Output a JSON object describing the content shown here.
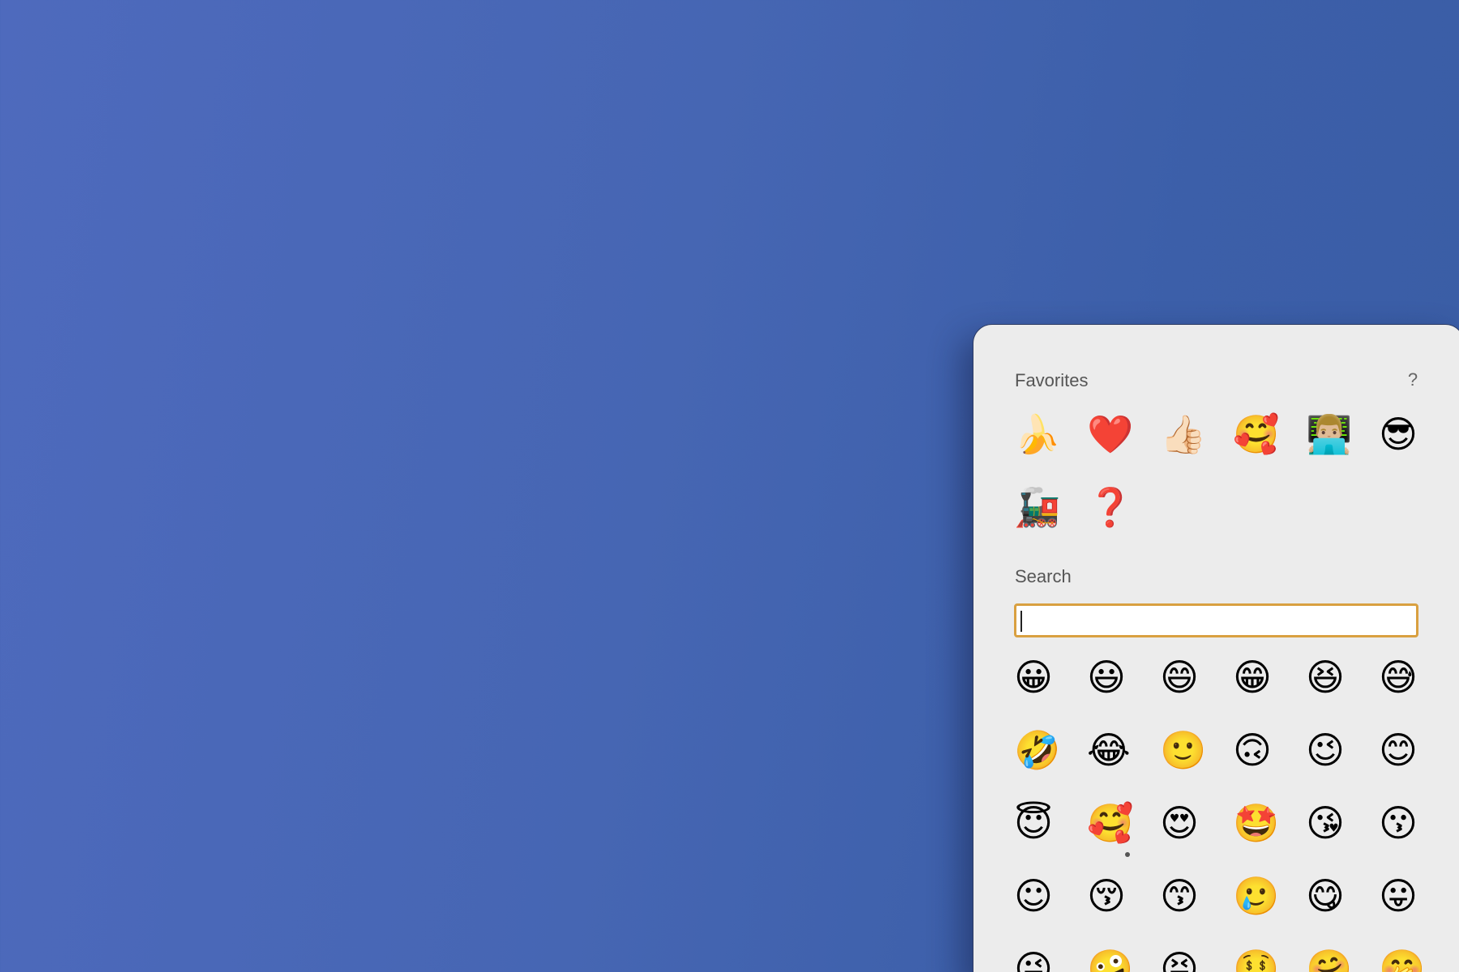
{
  "desktop": {
    "background_colors": [
      "#4e6abd",
      "#3a5da5"
    ]
  },
  "picker": {
    "favorites_title": "Favorites",
    "help_label": "?",
    "favorites": [
      {
        "emoji": "🍌",
        "icon": "banana-icon"
      },
      {
        "emoji": "❤️",
        "icon": "red-heart-icon"
      },
      {
        "emoji": "👍🏻",
        "icon": "thumbs-up-icon"
      },
      {
        "emoji": "🥰",
        "icon": "smiling-face-with-hearts-icon"
      },
      {
        "emoji": "👨🏼‍💻",
        "icon": "man-technologist-icon"
      },
      {
        "emoji": "😎",
        "icon": "sunglasses-face-icon"
      },
      {
        "emoji": "🚂",
        "icon": "locomotive-icon"
      },
      {
        "emoji": "❓",
        "icon": "red-question-mark-icon"
      }
    ],
    "search_title": "Search",
    "search": {
      "value": "",
      "placeholder": "",
      "focus_color": "#d9a040"
    },
    "emoji_list": [
      {
        "emoji": "😀",
        "icon": "grinning-face-icon"
      },
      {
        "emoji": "😃",
        "icon": "grinning-face-big-eyes-icon"
      },
      {
        "emoji": "😄",
        "icon": "grinning-face-smiling-eyes-icon"
      },
      {
        "emoji": "😁",
        "icon": "beaming-face-icon"
      },
      {
        "emoji": "😆",
        "icon": "squinting-face-icon"
      },
      {
        "emoji": "😅",
        "icon": "grinning-face-sweat-icon"
      },
      {
        "emoji": "🤣",
        "icon": "rolling-on-floor-laughing-icon"
      },
      {
        "emoji": "😂",
        "icon": "face-with-tears-of-joy-icon"
      },
      {
        "emoji": "🙂",
        "icon": "slightly-smiling-face-icon"
      },
      {
        "emoji": "🙃",
        "icon": "upside-down-face-icon"
      },
      {
        "emoji": "😉",
        "icon": "winking-face-icon"
      },
      {
        "emoji": "😊",
        "icon": "smiling-face-smiling-eyes-icon"
      },
      {
        "emoji": "😇",
        "icon": "smiling-face-with-halo-icon"
      },
      {
        "emoji": "🥰",
        "icon": "smiling-face-with-hearts-icon",
        "has_variants": true
      },
      {
        "emoji": "😍",
        "icon": "heart-eyes-face-icon"
      },
      {
        "emoji": "🤩",
        "icon": "star-struck-face-icon"
      },
      {
        "emoji": "😘",
        "icon": "face-blowing-kiss-icon"
      },
      {
        "emoji": "😗",
        "icon": "kissing-face-icon"
      },
      {
        "emoji": "☺",
        "icon": "smiling-face-outline-icon"
      },
      {
        "emoji": "😚",
        "icon": "kissing-face-closed-eyes-icon"
      },
      {
        "emoji": "😙",
        "icon": "kissing-face-smiling-eyes-icon"
      },
      {
        "emoji": "🥲",
        "icon": "smiling-face-with-tear-icon"
      },
      {
        "emoji": "😋",
        "icon": "face-savoring-food-icon"
      },
      {
        "emoji": "😛",
        "icon": "face-with-tongue-icon"
      },
      {
        "emoji": "😜",
        "icon": "winking-face-with-tongue-icon"
      },
      {
        "emoji": "🤪",
        "icon": "zany-face-icon"
      },
      {
        "emoji": "😝",
        "icon": "squinting-face-with-tongue-icon"
      },
      {
        "emoji": "🤑",
        "icon": "money-mouth-face-icon"
      },
      {
        "emoji": "🤗",
        "icon": "hugging-face-icon"
      },
      {
        "emoji": "🤭",
        "icon": "face-with-hand-over-mouth-icon"
      }
    ]
  }
}
